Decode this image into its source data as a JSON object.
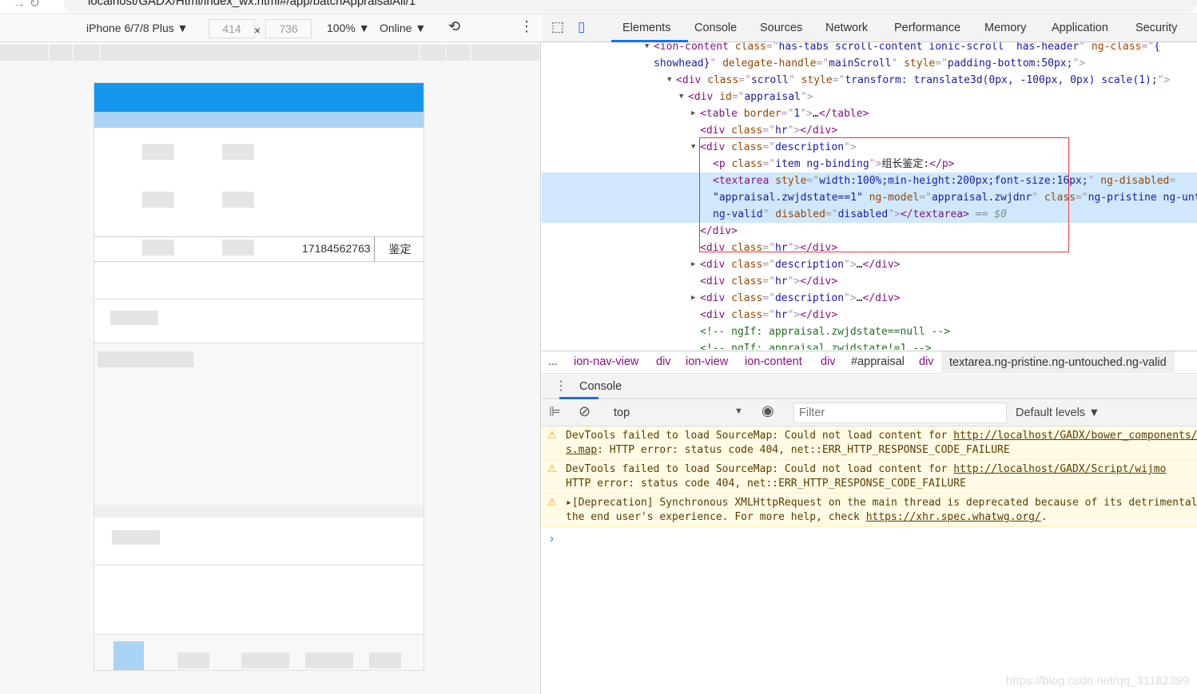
{
  "browser": {
    "url": "localhost/GADX/Html/index_wx.html#/app/batchAppraisalAll/1"
  },
  "device_toolbar": {
    "device": "iPhone 6/7/8 Plus ▼",
    "width": "414",
    "x": "×",
    "height": "736",
    "zoom": "100% ▼",
    "network": "Online ▼"
  },
  "phone": {
    "row_phone": "17184562763",
    "row_action": "鉴定"
  },
  "devtools": {
    "tabs": [
      "Elements",
      "Console",
      "Sources",
      "Network",
      "Performance",
      "Memory",
      "Application",
      "Security"
    ],
    "dom_lines": [
      {
        "indent": 818,
        "arrow": "down",
        "segs": [
          [
            "tg",
            "<ion-content "
          ],
          [
            "at",
            "class"
          ],
          [
            "pn",
            "=\""
          ],
          [
            "av",
            "has-tabs scroll-content ionic-scroll  has-header"
          ],
          [
            "pn",
            "\" "
          ],
          [
            "at",
            "ng-class"
          ],
          [
            "pn",
            "=\""
          ],
          [
            "av",
            "{"
          ]
        ]
      },
      {
        "indent": 818,
        "segs": [
          [
            "av",
            "showhead}"
          ],
          [
            "pn",
            "\" "
          ],
          [
            "at",
            "delegate-handle"
          ],
          [
            "pn",
            "=\""
          ],
          [
            "av",
            "mainScroll"
          ],
          [
            "pn",
            "\" "
          ],
          [
            "at",
            "style"
          ],
          [
            "pn",
            "=\""
          ],
          [
            "av",
            "padding-bottom:50px;"
          ],
          [
            "pn",
            "\">"
          ]
        ]
      },
      {
        "indent": 846,
        "arrow": "down",
        "segs": [
          [
            "tg",
            "<div "
          ],
          [
            "at",
            "class"
          ],
          [
            "pn",
            "=\""
          ],
          [
            "av",
            "scroll"
          ],
          [
            "pn",
            "\" "
          ],
          [
            "at",
            "style"
          ],
          [
            "pn",
            "=\""
          ],
          [
            "av",
            "transform: translate3d(0px, -100px, 0px) scale(1);"
          ],
          [
            "pn",
            "\">"
          ]
        ]
      },
      {
        "indent": 861,
        "arrow": "down",
        "segs": [
          [
            "tg",
            "<div "
          ],
          [
            "at",
            "id"
          ],
          [
            "pn",
            "=\""
          ],
          [
            "av",
            "appraisal"
          ],
          [
            "pn",
            "\">"
          ]
        ]
      },
      {
        "indent": 876,
        "arrow": "right",
        "segs": [
          [
            "tg",
            "<table "
          ],
          [
            "at",
            "border"
          ],
          [
            "pn",
            "=\""
          ],
          [
            "av",
            "1"
          ],
          [
            "pn",
            "\">"
          ],
          [
            "tx",
            "…"
          ],
          [
            "tg",
            "</table>"
          ]
        ]
      },
      {
        "indent": 876,
        "segs": [
          [
            "tg",
            "<div "
          ],
          [
            "at",
            "class"
          ],
          [
            "pn",
            "=\""
          ],
          [
            "av",
            "hr"
          ],
          [
            "pn",
            "\">"
          ],
          [
            "tg",
            "</div>"
          ]
        ]
      },
      {
        "indent": 876,
        "arrow": "down",
        "segs": [
          [
            "tg",
            "<div "
          ],
          [
            "at",
            "class"
          ],
          [
            "pn",
            "=\""
          ],
          [
            "av",
            "description"
          ],
          [
            "pn",
            "\">"
          ]
        ]
      },
      {
        "indent": 892,
        "segs": [
          [
            "tg",
            "<p "
          ],
          [
            "at",
            "class"
          ],
          [
            "pn",
            "=\""
          ],
          [
            "av",
            "item ng-binding"
          ],
          [
            "pn",
            "\">"
          ],
          [
            "tx",
            "组长鉴定:"
          ],
          [
            "tg",
            "</p>"
          ]
        ]
      },
      {
        "indent": 892,
        "sel": true,
        "segs": [
          [
            "tg",
            "<textarea "
          ],
          [
            "at",
            "style"
          ],
          [
            "pn",
            "=\""
          ],
          [
            "av",
            "width:100%;min-height:200px;font-size:16px;"
          ],
          [
            "pn",
            "\" "
          ],
          [
            "at",
            "ng-disabled"
          ],
          [
            "pn",
            "="
          ]
        ]
      },
      {
        "indent": 892,
        "sel": true,
        "segs": [
          [
            "av",
            "\"appraisal.zwjdstate==1\""
          ],
          [
            "pn",
            " "
          ],
          [
            "at",
            "ng-model"
          ],
          [
            "pn",
            "=\""
          ],
          [
            "av",
            "appraisal.zwjdnr"
          ],
          [
            "pn",
            "\" "
          ],
          [
            "at",
            "class"
          ],
          [
            "pn",
            "=\""
          ],
          [
            "av",
            "ng-pristine ng-untouched"
          ]
        ]
      },
      {
        "indent": 892,
        "sel": true,
        "segs": [
          [
            "av",
            "ng-valid"
          ],
          [
            "pn",
            "\" "
          ],
          [
            "at",
            "disabled"
          ],
          [
            "pn",
            "=\""
          ],
          [
            "av",
            "disabled"
          ],
          [
            "pn",
            "\">"
          ],
          [
            "tg",
            "</textarea>"
          ],
          [
            "dl",
            " == $0"
          ]
        ]
      },
      {
        "indent": 876,
        "segs": [
          [
            "tg",
            "</div>"
          ]
        ]
      },
      {
        "indent": 876,
        "segs": [
          [
            "tg",
            "<div "
          ],
          [
            "at",
            "class"
          ],
          [
            "pn",
            "=\""
          ],
          [
            "av",
            "hr"
          ],
          [
            "pn",
            "\">"
          ],
          [
            "tg",
            "</div>"
          ]
        ]
      },
      {
        "indent": 876,
        "arrow": "right",
        "segs": [
          [
            "tg",
            "<div "
          ],
          [
            "at",
            "class"
          ],
          [
            "pn",
            "=\""
          ],
          [
            "av",
            "description"
          ],
          [
            "pn",
            "\">"
          ],
          [
            "tx",
            "…"
          ],
          [
            "tg",
            "</div>"
          ]
        ]
      },
      {
        "indent": 876,
        "segs": [
          [
            "tg",
            "<div "
          ],
          [
            "at",
            "class"
          ],
          [
            "pn",
            "=\""
          ],
          [
            "av",
            "hr"
          ],
          [
            "pn",
            "\">"
          ],
          [
            "tg",
            "</div>"
          ]
        ]
      },
      {
        "indent": 876,
        "arrow": "right",
        "segs": [
          [
            "tg",
            "<div "
          ],
          [
            "at",
            "class"
          ],
          [
            "pn",
            "=\""
          ],
          [
            "av",
            "description"
          ],
          [
            "pn",
            "\">"
          ],
          [
            "tx",
            "…"
          ],
          [
            "tg",
            "</div>"
          ]
        ]
      },
      {
        "indent": 876,
        "segs": [
          [
            "tg",
            "<div "
          ],
          [
            "at",
            "class"
          ],
          [
            "pn",
            "=\""
          ],
          [
            "av",
            "hr"
          ],
          [
            "pn",
            "\">"
          ],
          [
            "tg",
            "</div>"
          ]
        ]
      },
      {
        "indent": 876,
        "segs": [
          [
            "cm",
            "<!-- ngIf: appraisal.zwjdstate==null -->"
          ]
        ]
      },
      {
        "indent": 876,
        "segs": [
          [
            "cm",
            "<!-- ngIf: appraisal.zwjdstate!=1 -->"
          ]
        ]
      }
    ],
    "breadcrumbs": [
      "...",
      "ion-nav-view",
      "div",
      "ion-view",
      "ion-content",
      "div",
      "#appraisal",
      "div",
      "textarea.ng-pristine.ng-untouched.ng-valid"
    ],
    "drawer_tab": "Console",
    "console_toolbar": {
      "context": "top",
      "filter_placeholder": "Filter",
      "levels": "Default levels ▼"
    },
    "messages": [
      {
        "l1": "DevTools failed to load SourceMap: Could not load content for ",
        "link1": "http://localhost/GADX/bower_components/",
        "l2pre": "",
        "link2": "s.map",
        "l2": ": HTTP error: status code 404, net::ERR_HTTP_RESPONSE_CODE_FAILURE"
      },
      {
        "l1": "DevTools failed to load SourceMap: Could not load content for ",
        "link1": "http://localhost/GADX/Script/wijmo",
        "l2pre": "",
        "link2": "",
        "l2": "HTTP error: status code 404, net::ERR_HTTP_RESPONSE_CODE_FAILURE"
      },
      {
        "l1": "▸[Deprecation] Synchronous XMLHttpRequest on the main thread is deprecated because of its detrimental effects to",
        "link1": "",
        "l2pre": "the end user's experience. For more help, check ",
        "link2": "https://xhr.spec.whatwg.org/",
        "l2": "."
      }
    ]
  },
  "watermark": "https://blog.csdn.net/qq_31182399",
  "colors": {
    "accent": "#1a73e8",
    "phone_header": "#1396ee",
    "selection": "#cfe8fc",
    "warning_bg": "#fffbe5"
  }
}
